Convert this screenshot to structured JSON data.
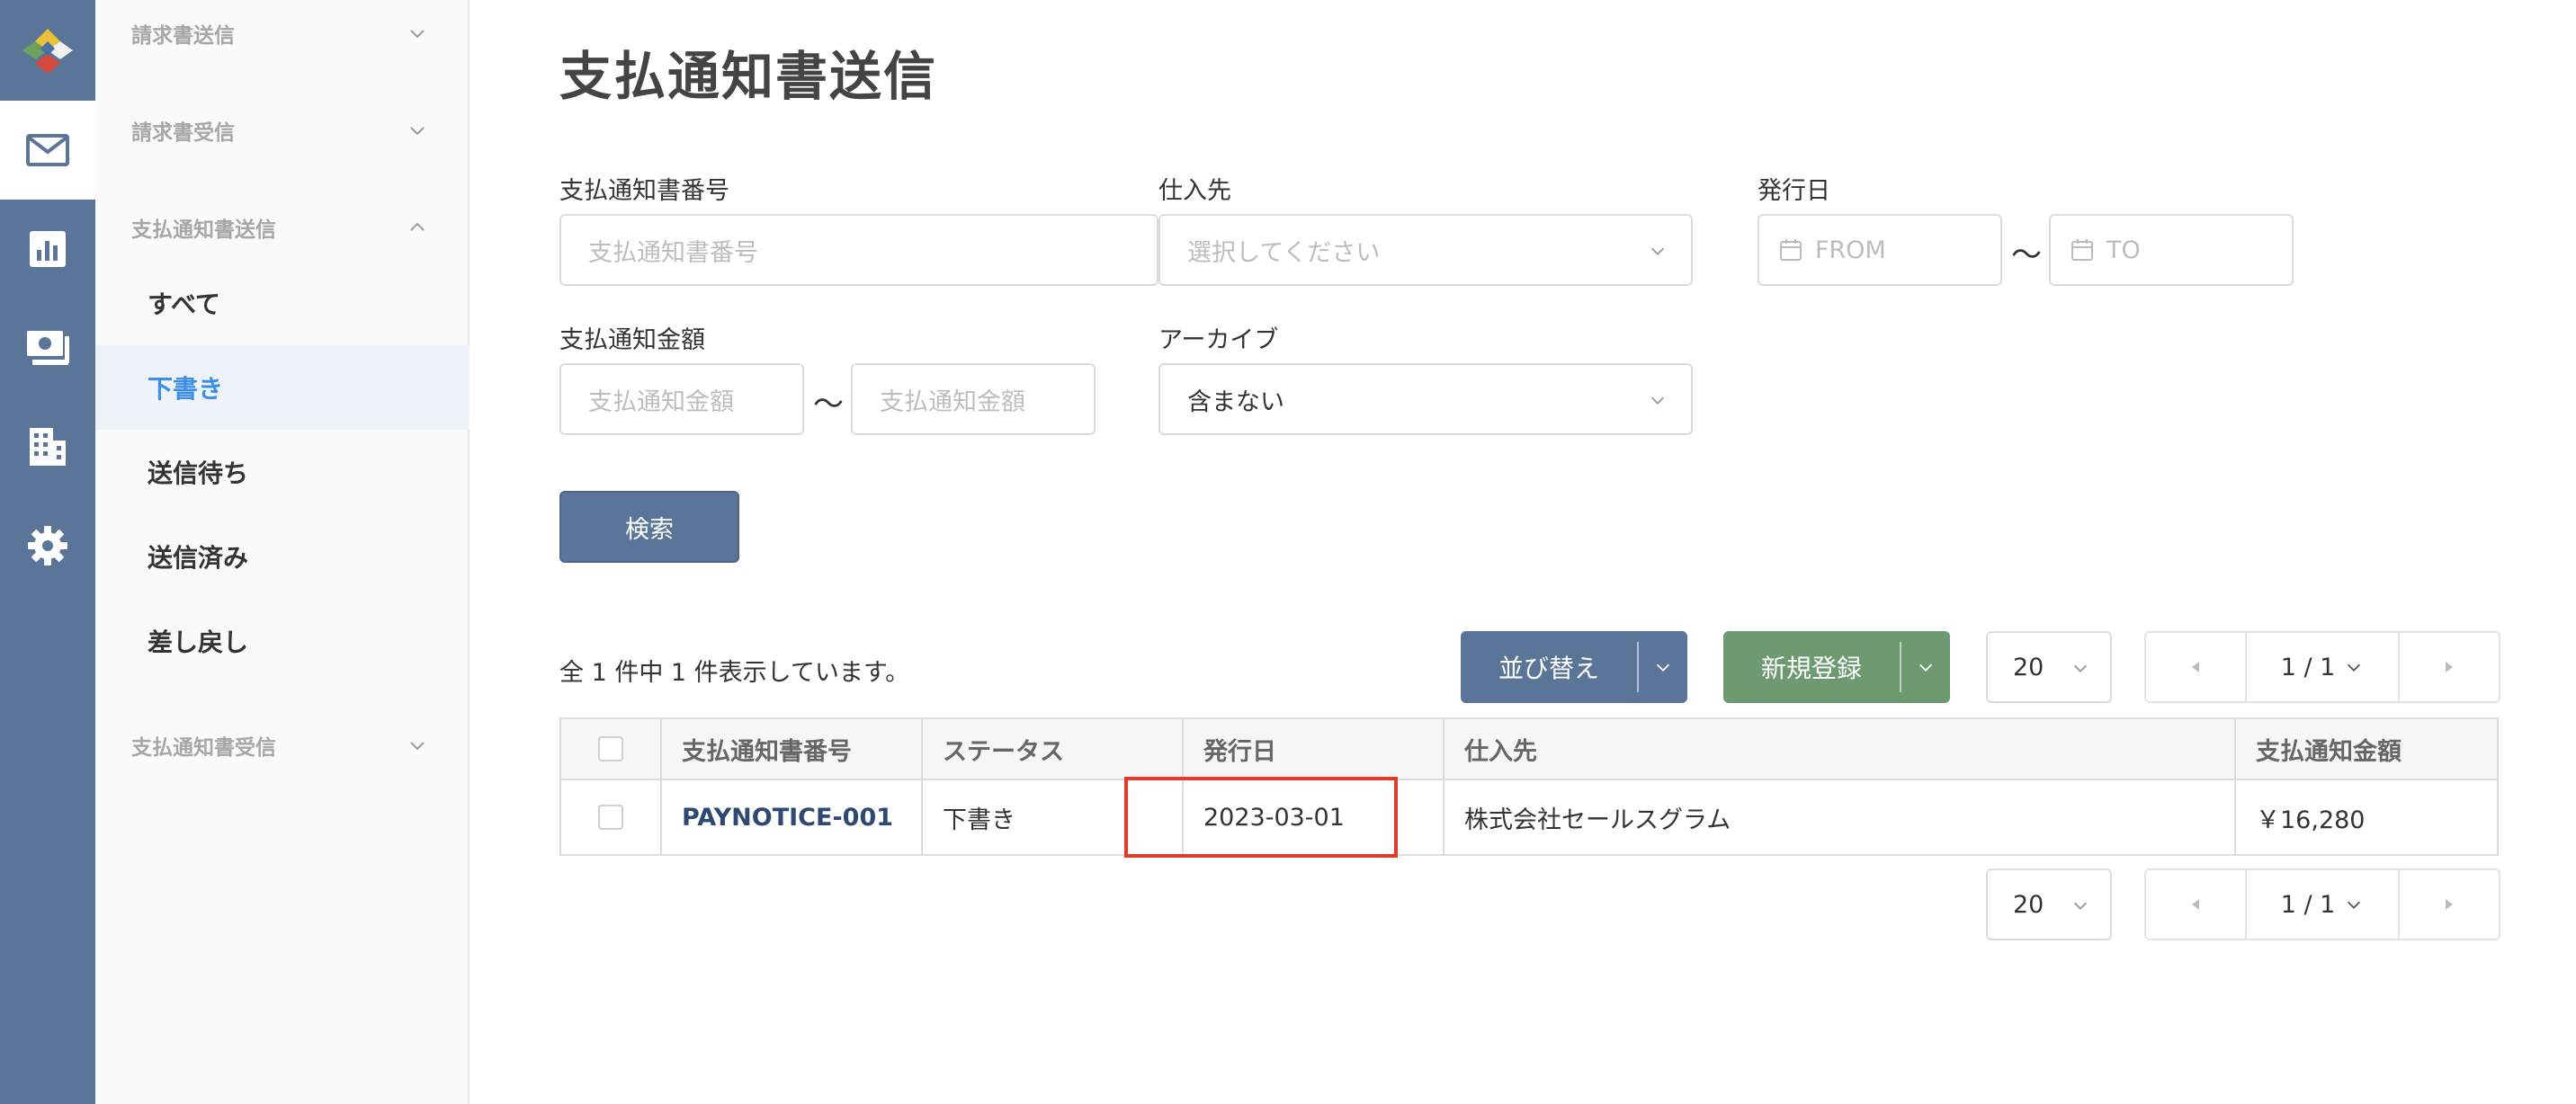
{
  "sidebar": {
    "groups": [
      {
        "label": "請求書送信",
        "expanded": false
      },
      {
        "label": "請求書受信",
        "expanded": false
      },
      {
        "label": "支払通知書送信",
        "expanded": true
      },
      {
        "label": "支払通知書受信",
        "expanded": false
      }
    ],
    "items": [
      {
        "label": "すべて",
        "active": false
      },
      {
        "label": "下書き",
        "active": true
      },
      {
        "label": "送信待ち",
        "active": false
      },
      {
        "label": "送信済み",
        "active": false
      },
      {
        "label": "差し戻し",
        "active": false
      }
    ]
  },
  "rail": {
    "icons": [
      "logo-icon",
      "mail-icon",
      "chart-icon",
      "payment-icon",
      "building-icon",
      "gear-icon"
    ],
    "active": "mail-icon"
  },
  "page": {
    "title": "支払通知書送信"
  },
  "filters": {
    "number_label": "支払通知書番号",
    "number_placeholder": "支払通知書番号",
    "supplier_label": "仕入先",
    "supplier_placeholder": "選択してください",
    "date_label": "発行日",
    "date_from_placeholder": "FROM",
    "date_to_placeholder": "TO",
    "amount_label": "支払通知金額",
    "amount_from_placeholder": "支払通知金額",
    "amount_to_placeholder": "支払通知金額",
    "archive_label": "アーカイブ",
    "archive_value": "含まない",
    "tilde": "〜",
    "search_button": "検索"
  },
  "list": {
    "summary": "全 1 件中 1 件表示しています。",
    "sort_button": "並び替え",
    "new_button": "新規登録",
    "per_page": "20",
    "page_indicator": "1 / 1",
    "columns": [
      "支払通知書番号",
      "ステータス",
      "発行日",
      "仕入先",
      "支払通知金額"
    ],
    "rows": [
      {
        "number": "PAYNOTICE-001",
        "status": "下書き",
        "date": "2023-03-01",
        "supplier": "株式会社セールスグラム",
        "amount": "￥16,280"
      }
    ]
  },
  "colors": {
    "rail": "#5a7598",
    "accent": "#3d8ee6",
    "new_button": "#6e9a72",
    "highlight": "#e03c28",
    "link": "#2e4a72"
  }
}
